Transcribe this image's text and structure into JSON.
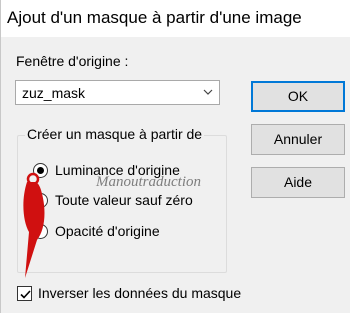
{
  "window": {
    "title": "Ajout d'un masque à partir d'une image"
  },
  "source": {
    "label": "Fenêtre d'origine :",
    "selected": "zuz_mask"
  },
  "buttons": {
    "ok": "OK",
    "cancel": "Annuler",
    "help": "Aide"
  },
  "group": {
    "label": "Créer un masque à partir de",
    "options": [
      {
        "label": "Luminance d'origine",
        "checked": true
      },
      {
        "label": "Toute valeur sauf zéro",
        "checked": false
      },
      {
        "label": "Opacité d'origine",
        "checked": false
      }
    ]
  },
  "invert": {
    "label": "Inverser les données du masque",
    "checked": true
  },
  "watermark": {
    "text": "Manoutraduction"
  },
  "colors": {
    "dialog_bg": "#f0f0f0",
    "default_button_border": "#0078d7",
    "pointer_red": "#d01010"
  },
  "icons": {
    "combo_arrow": "chevron-down-icon",
    "checkbox_mark": "checkmark-icon",
    "annotation": "red-pointer-arrow"
  }
}
